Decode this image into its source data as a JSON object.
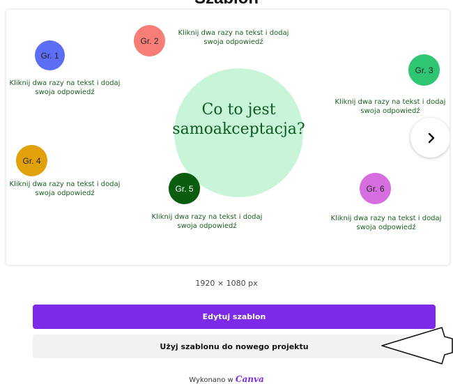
{
  "header": {
    "title": "Szablon"
  },
  "slide": {
    "question": "Co to jest samoakceptacja?",
    "groups": [
      {
        "label": "Gr. 1",
        "hint": "Kliknij dwa razy na tekst i dodaj swoja odpowiedź",
        "color": "#5c6ef5"
      },
      {
        "label": "Gr. 2",
        "hint": "Kliknij dwa razy na tekst i dodaj swoja odpowiedź",
        "color": "#f67e76"
      },
      {
        "label": "Gr. 3",
        "hint": "Kliknij dwa razy na tekst i dodaj swoja odpowiedź",
        "color": "#2ec573"
      },
      {
        "label": "Gr. 4",
        "hint": "Kliknij dwa razy na tekst i dodaj swoja odpowiedź",
        "color": "#e0a10a"
      },
      {
        "label": "Gr. 5",
        "hint": "Kliknij dwa razy na tekst i dodaj swoja odpowiedź",
        "color": "#0a5c0f"
      },
      {
        "label": "Gr. 6",
        "hint": "Kliknij dwa razy na tekst i dodaj swoja odpowiedź",
        "color": "#d66de0"
      }
    ],
    "center_color": "#c8f5d8",
    "next_icon": "chevron-right-icon"
  },
  "dimensions": "1920 × 1080 px",
  "buttons": {
    "edit_label": "Edytuj szablon",
    "edit_color": "#7d2ae8",
    "use_label": "Użyj szablonu do nowego projektu"
  },
  "footer": {
    "made_with": "Wykonano w",
    "brand": "Canva"
  }
}
